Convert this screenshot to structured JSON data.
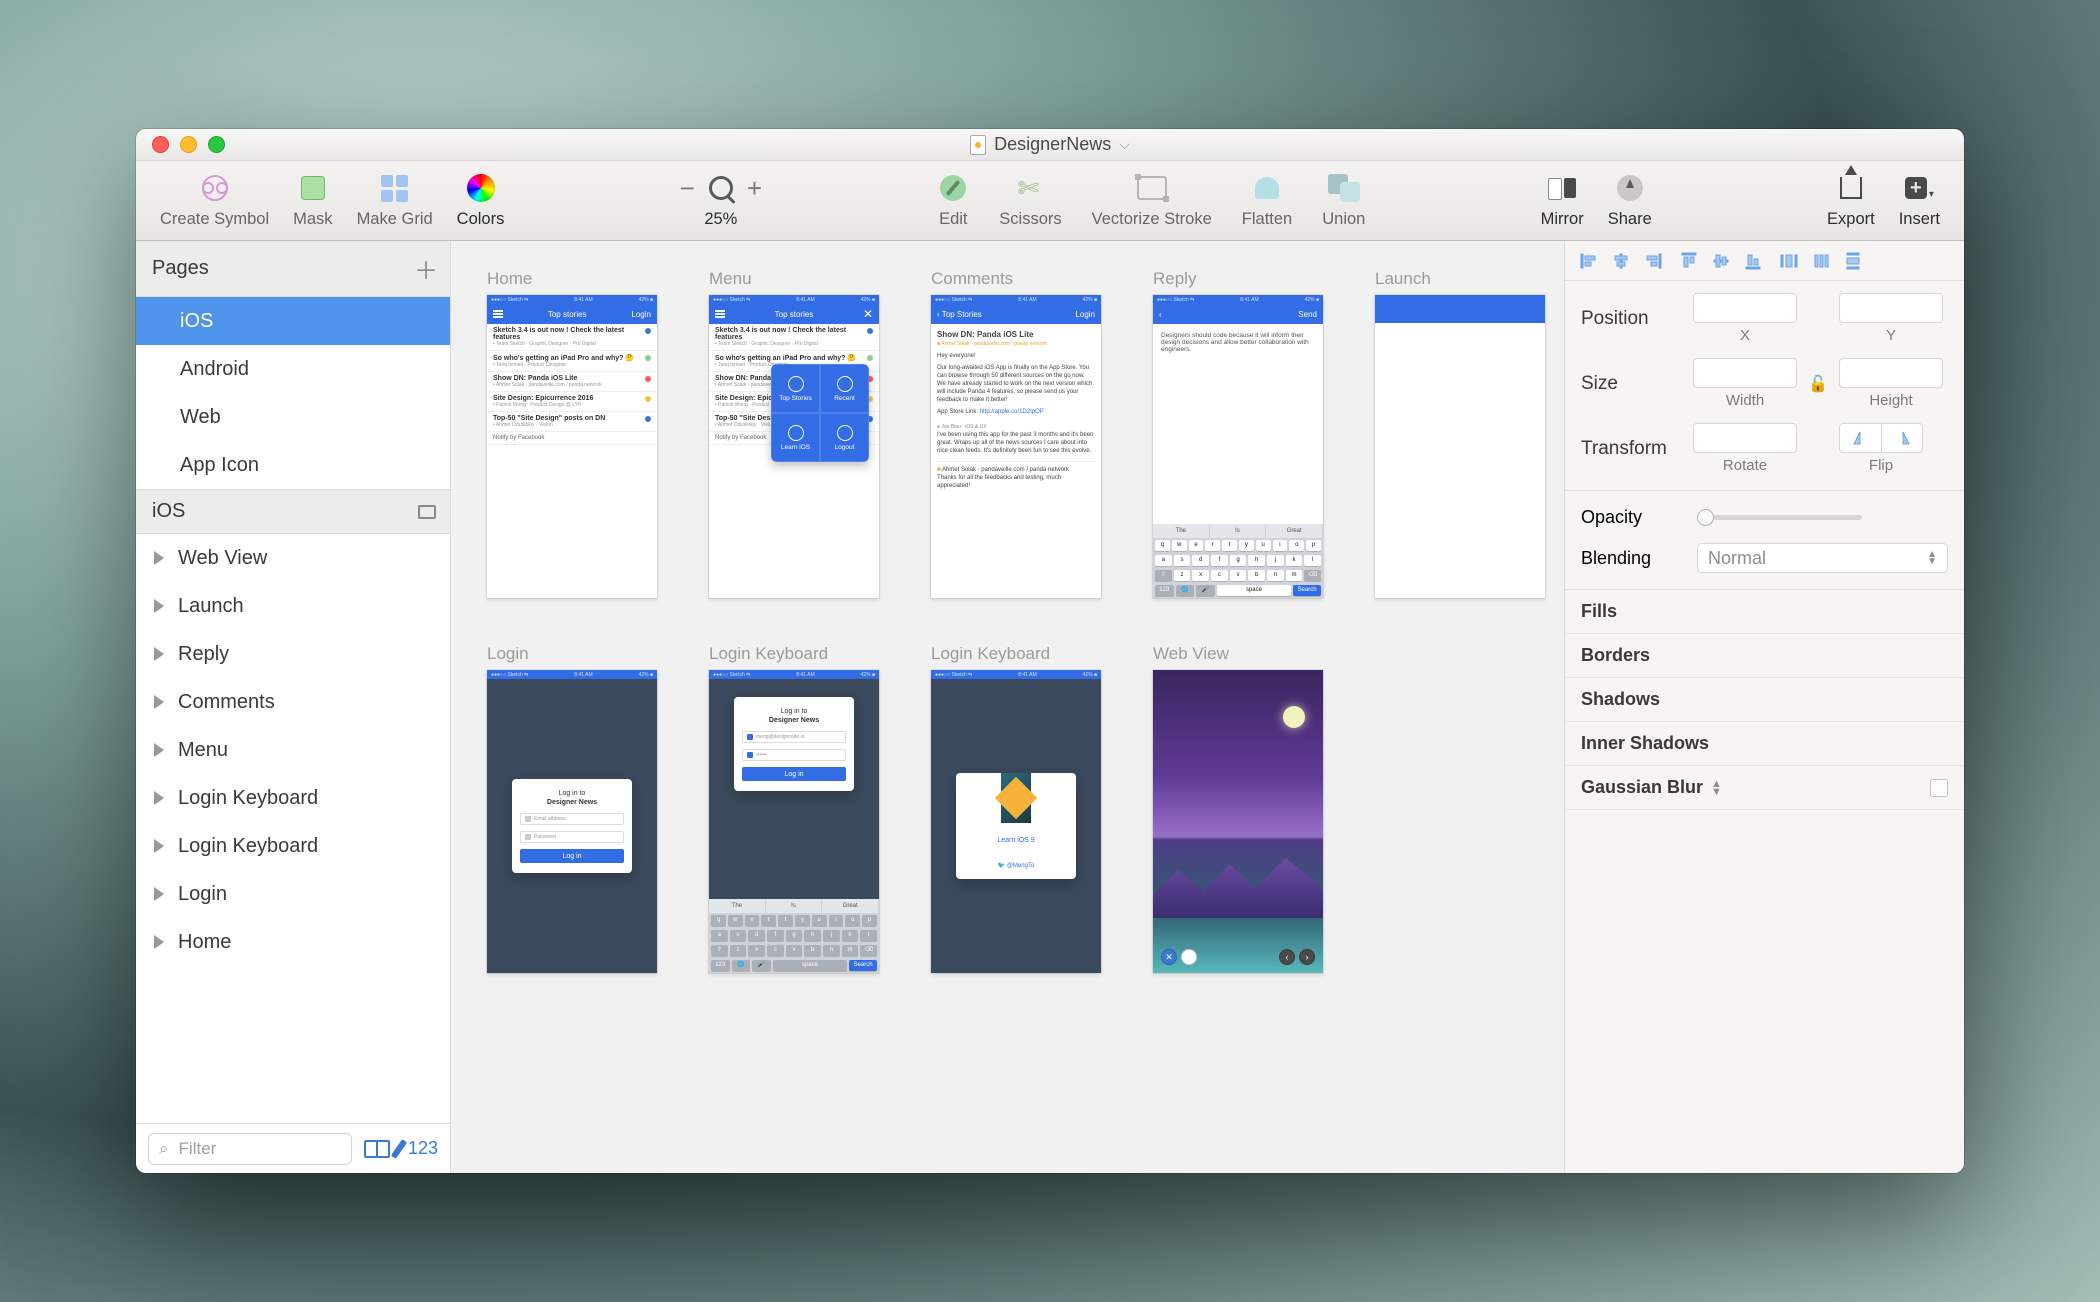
{
  "title": "DesignerNews",
  "toolbar": {
    "left": [
      {
        "name": "create-symbol",
        "label": "Create Symbol"
      },
      {
        "name": "mask",
        "label": "Mask"
      },
      {
        "name": "make-grid",
        "label": "Make Grid"
      },
      {
        "name": "colors",
        "label": "Colors"
      }
    ],
    "zoom": {
      "label": "25%",
      "minus": "−",
      "plus": "+"
    },
    "mid": [
      {
        "name": "edit",
        "label": "Edit"
      },
      {
        "name": "scissors",
        "label": "Scissors"
      },
      {
        "name": "vectorize-stroke",
        "label": "Vectorize Stroke"
      },
      {
        "name": "flatten",
        "label": "Flatten"
      },
      {
        "name": "union",
        "label": "Union"
      }
    ],
    "right": [
      {
        "name": "mirror",
        "label": "Mirror"
      },
      {
        "name": "share",
        "label": "Share"
      },
      {
        "name": "export",
        "label": "Export"
      },
      {
        "name": "insert",
        "label": "Insert"
      }
    ]
  },
  "left_panel": {
    "pages_header": "Pages",
    "pages": [
      {
        "label": "iOS",
        "active": true
      },
      {
        "label": "Android"
      },
      {
        "label": "Web"
      },
      {
        "label": "App Icon"
      }
    ],
    "section_header": "iOS",
    "layers": [
      "Web View",
      "Launch",
      "Reply",
      "Comments",
      "Menu",
      "Login Keyboard",
      "Login Keyboard",
      "Login",
      "Home"
    ],
    "filter_placeholder": "Filter",
    "filter_count": "123"
  },
  "canvas": {
    "artboards_row1": [
      "Home",
      "Menu",
      "Comments",
      "Reply",
      "Launch"
    ],
    "artboards_row2": [
      "Login",
      "Login Keyboard",
      "Login Keyboard",
      "Web View"
    ],
    "status": {
      "carrier": "Sketch",
      "time": "8:41 AM",
      "pct": "42%"
    },
    "nav": {
      "title": "Top stories",
      "right": "Login",
      "back": "Top Stories",
      "send": "Send"
    },
    "home_rows": [
      {
        "ttl": "Sketch 3.4 is out now ! Check the latest features",
        "sub": "Team Sketch · Graphic Designer · Pro Digital",
        "dot": "#3a78d6"
      },
      {
        "ttl": "So who's getting an iPad Pro and why? 🤔",
        "sub": "Tariq Ismael · Product Designer",
        "dot": "#8ad08e"
      },
      {
        "ttl": "Show DN: Panda iOS Lite",
        "sub": "Ahmet Solak · pandaveille.com / panda network",
        "dot": "#ff5a5a"
      },
      {
        "ttl": "Site Design: Epicurrence 2016",
        "sub": "Patrick Wong · Product Design @ LYft",
        "dot": "#f3c445"
      },
      {
        "ttl": "Top-50 \"Site Design\" posts on DN",
        "sub": "Ahmet Özkökskiy · Vielun",
        "dot": "#3a78d6"
      }
    ],
    "home_footer": "Notify by Facebook",
    "menu_items": [
      "Top Stories",
      "Recent",
      "Learn iOS",
      "Logout"
    ],
    "comments": {
      "title": "Show DN: Panda iOS Lite",
      "author": "Ahmet Solak · pandaveille.com / panda network",
      "body": "Hey everyone!",
      "body2": "Our long-awaited iOS App is finally on the App Store. You can browse through 50 different sources on the go now. We have already started to work on the next version which will include Panda 4 features, so please send us your feedback to make it better!",
      "link_lbl": "App Store Link:",
      "link": "http://apple.co/1D2IpOP",
      "reply1": "I've been using this app for the past 3 months and it's been great. Wraps up all of the news sources I care about into nice clean feeds. It's definitely been fun to see this evolve.",
      "reply_author": "Joe Blau · iOS & UX",
      "thanks": "Thanks for all the feedbacks and testing, much appreciated!"
    },
    "reply": {
      "body": "Designers should code because it will inform their design decisions and allow better collaboration with engineers.",
      "sug": [
        "The",
        "Is",
        "Great"
      ],
      "rows": [
        [
          "q",
          "w",
          "e",
          "r",
          "t",
          "y",
          "u",
          "i",
          "o",
          "p"
        ],
        [
          "a",
          "s",
          "d",
          "f",
          "g",
          "h",
          "j",
          "k",
          "l"
        ],
        [
          "z",
          "x",
          "c",
          "v",
          "b",
          "n",
          "m"
        ]
      ],
      "space": "space",
      "search": "Search",
      "num": "123"
    },
    "login": {
      "card_hdr": "Log in to",
      "card_hdr2": "Designer News",
      "email_ph": "Email address",
      "pass_ph": "Password",
      "btn": "Log in",
      "email_val": "meng@designcode.io",
      "pass_val": "••••••",
      "learn": "Learn iOS 9",
      "twitter": "@MengTo"
    }
  },
  "inspector": {
    "position": "Position",
    "x": "X",
    "y": "Y",
    "size": "Size",
    "width": "Width",
    "height": "Height",
    "transform": "Transform",
    "rotate": "Rotate",
    "flip": "Flip",
    "opacity": "Opacity",
    "blending": "Blending",
    "blend_val": "Normal",
    "sections": [
      "Fills",
      "Borders",
      "Shadows",
      "Inner Shadows"
    ],
    "blur": "Gaussian Blur"
  }
}
